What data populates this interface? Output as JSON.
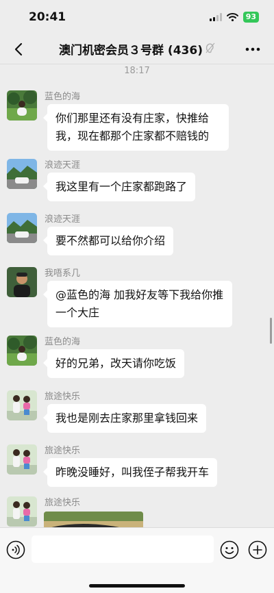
{
  "status_bar": {
    "time": "20:41",
    "battery": "93"
  },
  "header": {
    "title": "澳门机密会员３号群 (436)"
  },
  "chat": {
    "timestamp": "18:17",
    "messages": [
      {
        "sender": "蓝色的海",
        "text": "你们那里还有没有庄家，快推给我，现在都那个庄家都不赔钱的",
        "avatar": "person-lawn"
      },
      {
        "sender": "浪迹天涯",
        "text": "我这里有一个庄家都跑路了",
        "avatar": "car-mountains"
      },
      {
        "sender": "浪迹天涯",
        "text": "要不然都可以给你介绍",
        "avatar": "car-mountains"
      },
      {
        "sender": "我唔系几",
        "text": "@蓝色的海 加我好友等下我给你推一个大庄",
        "avatar": "man-photo"
      },
      {
        "sender": "蓝色的海",
        "text": "好的兄弟，改天请你吃饭",
        "avatar": "person-lawn"
      },
      {
        "sender": "旅途快乐",
        "text": "我也是刚去庄家那里拿钱回来",
        "avatar": "two-kids"
      },
      {
        "sender": "旅途快乐",
        "text": "昨晚没睡好，叫我侄子帮我开车",
        "avatar": "two-kids"
      },
      {
        "sender": "旅途快乐",
        "text": "",
        "avatar": "two-kids",
        "image": "car-photo"
      }
    ]
  },
  "input": {
    "placeholder": ""
  },
  "colors": {
    "background": "#ededed",
    "bubble": "#ffffff",
    "battery": "#34c759"
  }
}
